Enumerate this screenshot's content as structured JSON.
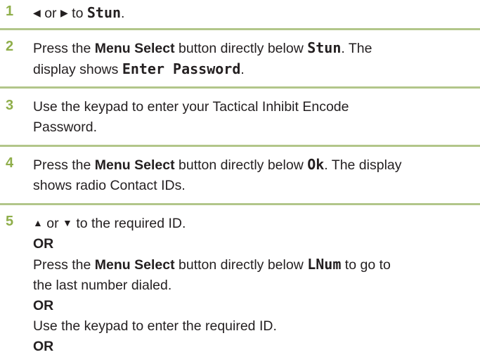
{
  "step1": {
    "number": "1",
    "left_icon": "arrow-left-icon",
    "left_glyph": "◀",
    "or": " or ",
    "right_icon": "arrow-right-icon",
    "right_glyph": "▶",
    "to": " to ",
    "target": "Stun",
    "end": "."
  },
  "step2": {
    "number": "2",
    "p1": "Press the ",
    "menu_select": "Menu Select",
    "p2": " button directly below ",
    "target": "Stun",
    "p3": ". The",
    "line2_a": "display shows ",
    "display_value": "Enter Password",
    "line2_end": "."
  },
  "step3": {
    "number": "3",
    "line1": "Use the keypad to enter your Tactical Inhibit Encode",
    "line2": "Password."
  },
  "step4": {
    "number": "4",
    "p1": "Press the ",
    "menu_select": "Menu Select",
    "p2": " button directly below ",
    "target": "Ok",
    "p3": ". The display",
    "line2": "shows radio Contact IDs."
  },
  "step5": {
    "number": "5",
    "up_icon": "arrow-up-icon",
    "up_glyph": "▲",
    "or": " or ",
    "down_icon": "arrow-down-icon",
    "down_glyph": "▼",
    "line1_end": " to the required ID.",
    "or1": "OR",
    "p1": "Press the ",
    "menu_select": "Menu Select",
    "p2": " button directly below ",
    "target": "LNum",
    "p3": " to go to",
    "line_b": "the last number dialed.",
    "or2": "OR",
    "line_c": "Use the keypad to enter the required ID.",
    "or3": "OR"
  },
  "colors": {
    "step_number": "#8fae4a",
    "rule": "#b2c68a",
    "text": "#231f20"
  }
}
